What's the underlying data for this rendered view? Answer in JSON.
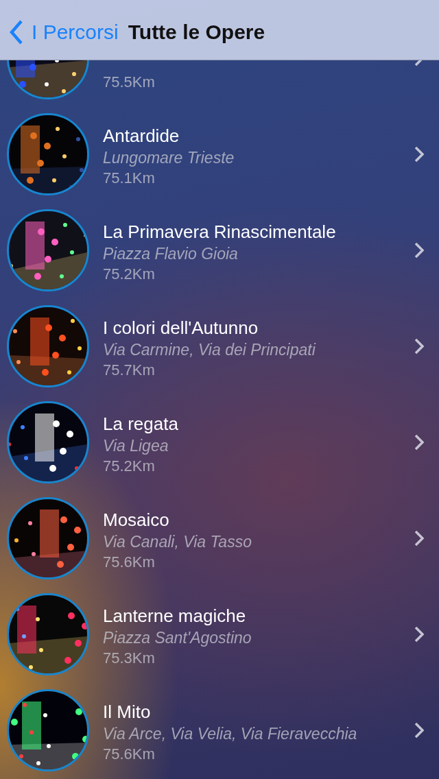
{
  "nav_bar": {
    "back_label": "I Percorsi",
    "title": "Tutte le Opere"
  },
  "items": [
    {
      "kind": "picture",
      "distance": "75.5Km"
    },
    {
      "kind": "picture",
      "title": "Antardide",
      "location": "Lungomare Trieste",
      "distance": "75.1Km"
    },
    {
      "kind": "picture",
      "title": "La Primavera Rinascimentale",
      "location": "Piazza Flavio Gioia",
      "distance": "75.2Km"
    },
    {
      "kind": "picture",
      "title": "I colori dell'Autunno",
      "location": "Via Carmine, Via dei Principati",
      "distance": "75.7Km"
    },
    {
      "kind": "picture",
      "title": "La regata",
      "location": "Via Ligea",
      "distance": "75.2Km"
    },
    {
      "kind": "picture",
      "title": "Mosaico",
      "location": "Via Canali, Via Tasso",
      "distance": "75.6Km"
    },
    {
      "kind": "picture",
      "title": "Lanterne magiche",
      "location": "Piazza Sant'Agostino",
      "distance": "75.3Km"
    },
    {
      "kind": "picture",
      "title": "Il Mito",
      "location": "Via Arce, Via Velia, Via Fieravecchia",
      "distance": "75.6Km"
    }
  ]
}
